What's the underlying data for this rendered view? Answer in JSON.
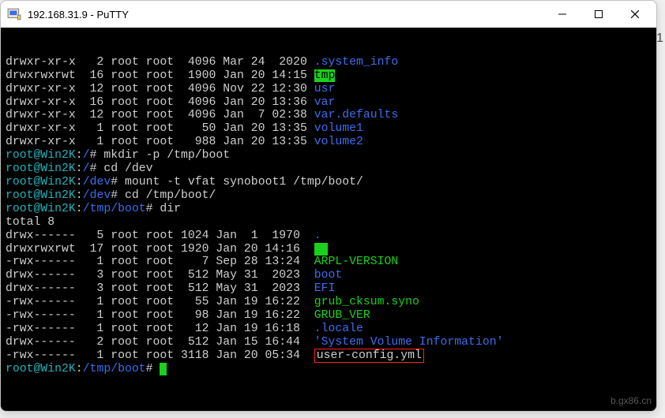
{
  "window": {
    "title": "192.168.31.9 - PuTTY"
  },
  "ls_root": [
    {
      "perm": "drwxr-xr-x",
      "n": " 2",
      "own": "root root",
      "size": " 4096",
      "date": "Mar 24  2020",
      "name": ".system_info",
      "cls": "blu"
    },
    {
      "perm": "drwxrwxrwt",
      "n": "16",
      "own": "root root",
      "size": " 1900",
      "date": "Jan 20 14:15",
      "name": "tmp",
      "cls": "grn-bg"
    },
    {
      "perm": "drwxr-xr-x",
      "n": "12",
      "own": "root root",
      "size": " 4096",
      "date": "Nov 22 12:30",
      "name": "usr",
      "cls": "blu"
    },
    {
      "perm": "drwxr-xr-x",
      "n": "16",
      "own": "root root",
      "size": " 4096",
      "date": "Jan 20 13:36",
      "name": "var",
      "cls": "blu"
    },
    {
      "perm": "drwxr-xr-x",
      "n": "12",
      "own": "root root",
      "size": " 4096",
      "date": "Jan  7 02:38",
      "name": "var.defaults",
      "cls": "blu"
    },
    {
      "perm": "drwxr-xr-x",
      "n": " 1",
      "own": "root root",
      "size": "   50",
      "date": "Jan 20 13:35",
      "name": "volume1",
      "cls": "blu"
    },
    {
      "perm": "drwxr-xr-x",
      "n": " 1",
      "own": "root root",
      "size": "  988",
      "date": "Jan 20 13:35",
      "name": "volume2",
      "cls": "blu"
    }
  ],
  "prompts": [
    {
      "user": "root@Win2K",
      "path": "/",
      "cmd": "mkdir -p /tmp/boot"
    },
    {
      "user": "root@Win2K",
      "path": "/",
      "cmd": "cd /dev"
    },
    {
      "user": "root@Win2K",
      "path": "/dev",
      "cmd": "mount -t vfat synoboot1 /tmp/boot/"
    },
    {
      "user": "root@Win2K",
      "path": "/dev",
      "cmd": "cd /tmp/boot/"
    },
    {
      "user": "root@Win2K",
      "path": "/tmp/boot",
      "cmd": "dir"
    }
  ],
  "total_line": "total 8",
  "ls_boot": [
    {
      "perm": "drwx------",
      "n": " 5",
      "own": "root root",
      "size": "1024",
      "date": "Jan  1  1970",
      "name": ".",
      "cls": "blu"
    },
    {
      "perm": "drwxrwxrwt",
      "n": "17",
      "own": "root root",
      "size": "1920",
      "date": "Jan 20 14:16",
      "name": "..",
      "cls": "grn-bg-box"
    },
    {
      "perm": "-rwx------",
      "n": " 1",
      "own": "root root",
      "size": "   7",
      "date": "Sep 28 13:24",
      "name": "ARPL-VERSION",
      "cls": "grn"
    },
    {
      "perm": "drwx------",
      "n": " 3",
      "own": "root root",
      "size": " 512",
      "date": "May 31  2023",
      "name": "boot",
      "cls": "blu"
    },
    {
      "perm": "drwx------",
      "n": " 3",
      "own": "root root",
      "size": " 512",
      "date": "May 31  2023",
      "name": "EFI",
      "cls": "blu"
    },
    {
      "perm": "-rwx------",
      "n": " 1",
      "own": "root root",
      "size": "  55",
      "date": "Jan 19 16:22",
      "name": "grub_cksum.syno",
      "cls": "grn"
    },
    {
      "perm": "-rwx------",
      "n": " 1",
      "own": "root root",
      "size": "  98",
      "date": "Jan 19 16:22",
      "name": "GRUB_VER",
      "cls": "grn"
    },
    {
      "perm": "-rwx------",
      "n": " 1",
      "own": "root root",
      "size": "  12",
      "date": "Jan 19 16:18",
      "name": ".locale",
      "cls": "blu"
    },
    {
      "perm": "drwx------",
      "n": " 2",
      "own": "root root",
      "size": " 512",
      "date": "Jan 15 16:44",
      "name": "'System Volume Information'",
      "cls": "blu"
    },
    {
      "perm": "-rwx------",
      "n": " 1",
      "own": "root root",
      "size": "3118",
      "date": "Jan 20 05:34",
      "name": "user-config.yml",
      "cls": "redbox"
    }
  ],
  "final_prompt": {
    "user": "root@Win2K",
    "path": "/tmp/boot"
  },
  "watermark": "b.gx86.cn",
  "side_digit": "1"
}
